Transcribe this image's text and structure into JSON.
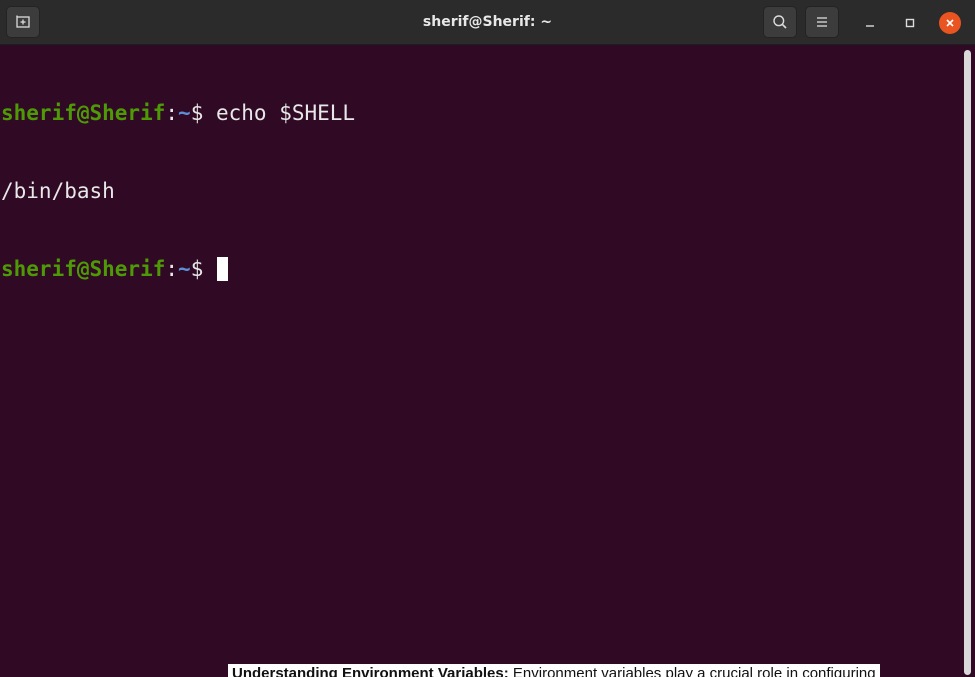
{
  "window": {
    "title": "sherif@Sherif: ~"
  },
  "terminal": {
    "lines": [
      {
        "user": "sherif@Sherif",
        "colon": ":",
        "path": "~",
        "dollar": "$",
        "command": " echo $SHELL"
      },
      {
        "output": "/bin/bash"
      },
      {
        "user": "sherif@Sherif",
        "colon": ":",
        "path": "~",
        "dollar": "$",
        "command": " "
      }
    ]
  },
  "background_page": {
    "bold_text": "Understanding Environment Variables:",
    "text": " Environment variables play a crucial role in configuring"
  },
  "colors": {
    "terminal_bg": "#300a24",
    "prompt_user": "#4e9a06",
    "prompt_path": "#5c8fd6",
    "close_button": "#e95420"
  },
  "icons": {
    "new_tab": "new-tab-icon",
    "search": "search-icon",
    "menu": "hamburger-menu-icon",
    "minimize": "minimize-icon",
    "maximize": "maximize-icon",
    "close": "close-icon"
  }
}
